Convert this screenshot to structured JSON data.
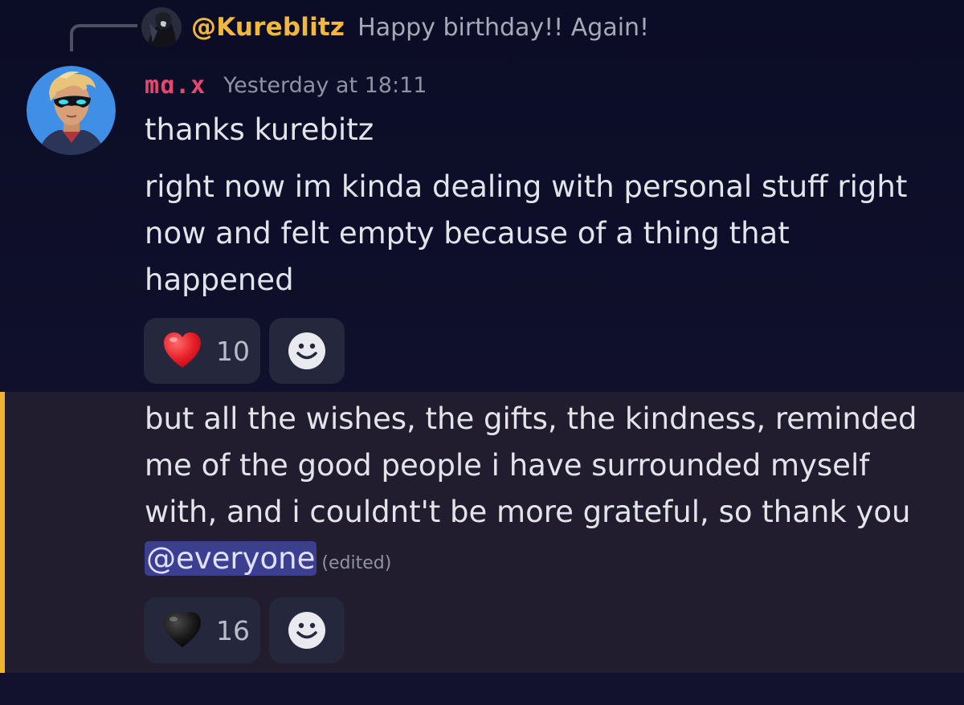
{
  "reply": {
    "author": "@Kureblitz",
    "text": "Happy birthday!! Again!"
  },
  "message": {
    "username": "mɑ.x",
    "timestamp": "Yesterday at 18:11",
    "lines": [
      "thanks kurebitz",
      "right now im kinda dealing with personal stuff right",
      "now and felt empty because of a thing that",
      "happened"
    ],
    "reactions": [
      {
        "emoji": "red-heart",
        "count": "10"
      }
    ]
  },
  "followup": {
    "lines": [
      "but all the wishes, the gifts, the kindness, reminded",
      "me of the good people i have surrounded myself",
      "with, and i couldnt't be more grateful, so thank you"
    ],
    "mention": "@everyone",
    "edited_label": "(edited)",
    "reactions": [
      {
        "emoji": "black-heart",
        "count": "16"
      }
    ]
  },
  "colors": {
    "background": "#0e0f2a",
    "reply_author": "#f2b83c",
    "username": "#e8466c",
    "mention_bg": "#3c3f8f",
    "highlight_bar": "#f0b232",
    "reaction_bg": "#25273d"
  },
  "icons": {
    "add_reaction": "smile-icon"
  }
}
